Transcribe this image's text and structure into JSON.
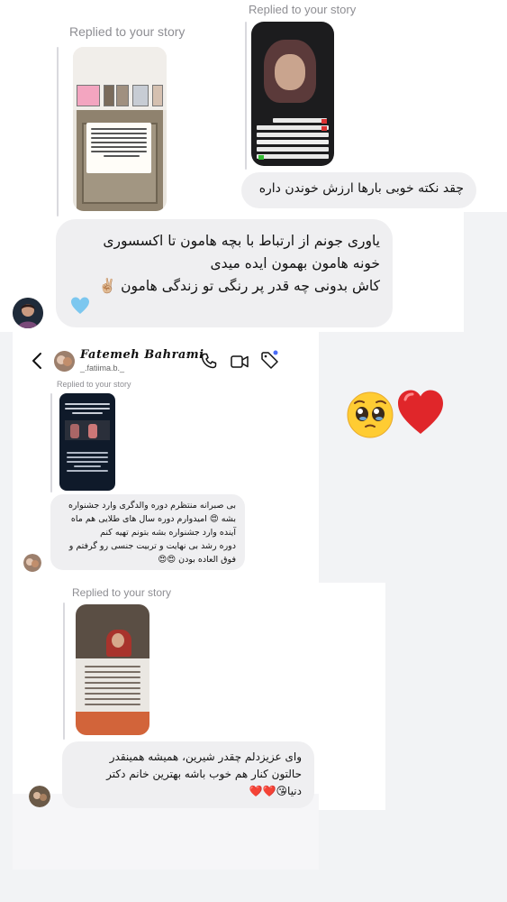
{
  "colors": {
    "bubble_bg": "#efeff1",
    "replied_text": "#8e8e93",
    "heart": "#e0262a",
    "light_blue_heart": "#7cc7ef",
    "unread_dot": "#4a6cf7"
  },
  "section_top": {
    "story_reply_label_left": "Replied to your story",
    "story_reply_label_right": "Replied to your story",
    "message_right": "چقد نکته خوبی بارها ارزش خوندن داره",
    "message_main_line1": "یاوری جونم از ارتباط با بچه هامون تا اکسسوری",
    "message_main_line2": "خونه هامون  بهمون ایده میدی",
    "message_main_line3": "کاش بدونی چه قدر پر رنگی تو زندگی هامون",
    "message_main_emoji": "✌🏼",
    "message_main_heart": "🩵"
  },
  "section_mid": {
    "contact_name": "Fatemeh Bahrami",
    "contact_username": "_.fatiima.b._",
    "icons": [
      "back-arrow-icon",
      "chevron-right-icon",
      "phone-icon",
      "video-call-icon",
      "tag-icon"
    ],
    "story_reply_label": "Replied to your story",
    "message_line1": "بی صبرانه منتظرم دوره والدگری وارد جشنواره",
    "message_line2": "بشه 😍 امیدوارم دوره سال های طلایی هم ماه",
    "message_line3": "آینده وارد جشنواره بشه بتونم تهیه کنم",
    "message_line4": "دوره رشد بی نهایت و تربیت جنسی رو گرفتم و",
    "message_line5": "فوق العاده بودن 😍😍",
    "side_emojis": "🥹❤️"
  },
  "section_bottom": {
    "story_reply_label": "Replied to your story",
    "message_line1": "وای عزیزدلم چقدر شیرین، همیشه همینقدر",
    "message_line2": "حالتون کنار هم خوب باشه بهترین خانم دکتر",
    "message_line3": "دنیا😘❤️❤️"
  }
}
